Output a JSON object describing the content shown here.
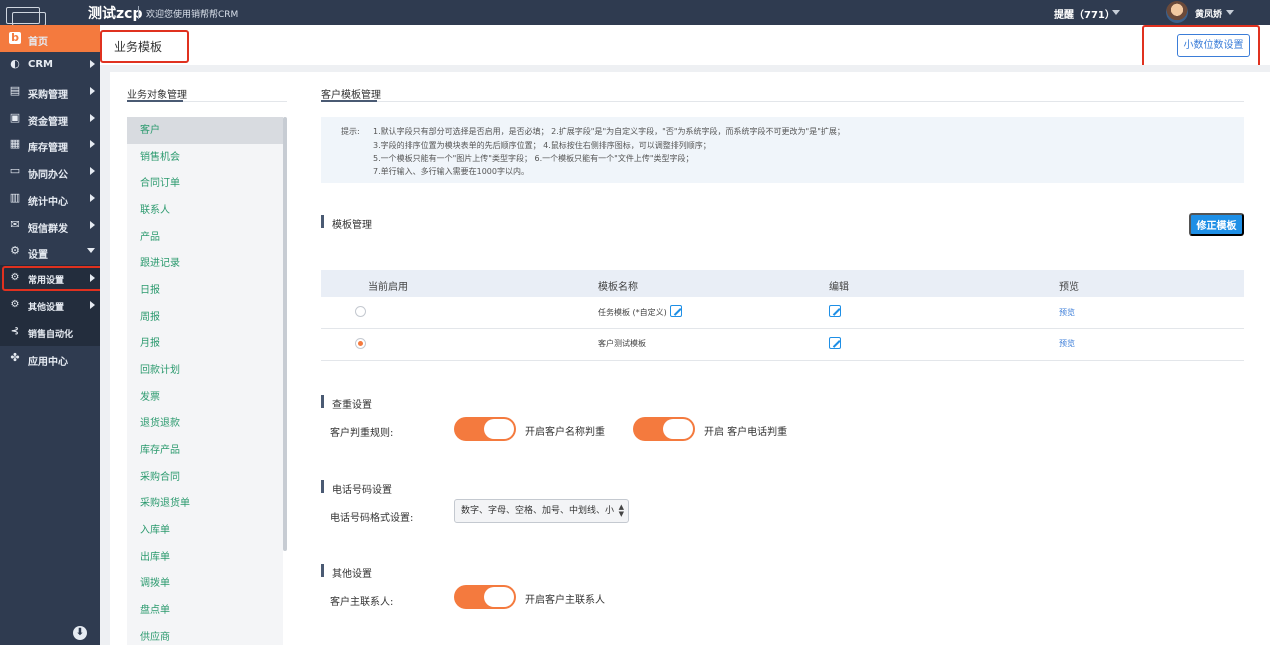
{
  "topbar": {
    "brand": "测试zcp",
    "welcome": "欢迎您使用销帮帮CRM",
    "remind": "提醒（771）",
    "username": "黄凤娇"
  },
  "sidebar": {
    "items": [
      {
        "label": "首页",
        "icon": "home-icon"
      },
      {
        "label": "CRM",
        "icon": "pie-chart-icon"
      },
      {
        "label": "采购管理",
        "icon": "purchase-icon"
      },
      {
        "label": "资金管理",
        "icon": "money-icon"
      },
      {
        "label": "库存管理",
        "icon": "inventory-icon"
      },
      {
        "label": "协同办公",
        "icon": "briefcase-icon"
      },
      {
        "label": "统计中心",
        "icon": "stats-icon"
      },
      {
        "label": "短信群发",
        "icon": "mail-icon"
      },
      {
        "label": "设置",
        "icon": "gear-icon"
      },
      {
        "label": "常用设置",
        "icon": "gear-icon"
      },
      {
        "label": "其他设置",
        "icon": "gear-icon"
      },
      {
        "label": "销售自动化",
        "icon": "automation-icon"
      },
      {
        "label": "应用中心",
        "icon": "apps-icon"
      }
    ]
  },
  "header": {
    "title": "业务模板",
    "decimal_button": "小数位数设置"
  },
  "objects": {
    "tab": "业务对象管理",
    "items": [
      "客户",
      "销售机会",
      "合同订单",
      "联系人",
      "产品",
      "跟进记录",
      "日报",
      "周报",
      "月报",
      "回款计划",
      "发票",
      "退货退款",
      "库存产品",
      "采购合同",
      "采购退货单",
      "入库单",
      "出库单",
      "调拨单",
      "盘点单",
      "供应商"
    ]
  },
  "customer": {
    "tab": "客户模板管理",
    "tips": {
      "label": "提示:",
      "lines": [
        "1.默认字段只有部分可选择是否启用，是否必填；    2.扩展字段\"是\"为自定义字段，\"否\"为系统字段，而系统字段不可更改为\"是\"扩展；",
        "3.字段的排序位置为模块表单的先后顺序位置；    4.鼠标按住右侧排序图标，可以调整排列顺序；",
        "5.一个模板只能有一个\"图片上传\"类型字段；    6.一个模板只能有一个\"文件上传\"类型字段；",
        "7.单行输入、多行输入需要在1000字以内。"
      ]
    },
    "template_section": {
      "title": "模板管理",
      "fix_button": "修正模板",
      "columns": [
        "当前启用",
        "模板名称",
        "编辑",
        "预览"
      ],
      "rows": [
        {
          "name": "任务模板 (*自定义)",
          "active": false,
          "preview": "预览"
        },
        {
          "name": "客户测试模板",
          "active": true,
          "preview": "预览"
        }
      ]
    },
    "dedupe": {
      "title": "查重设置",
      "label": "客户判重规则:",
      "toggle1": "开启客户名称判重",
      "toggle2": "开启 客户电话判重"
    },
    "phone": {
      "title": "电话号码设置",
      "label": "电话号码格式设置:",
      "selected": "数字、字母、空格、加号、中划线、小"
    },
    "other": {
      "title": "其他设置",
      "label": "客户主联系人:",
      "toggle": "开启客户主联系人"
    }
  },
  "colors": {
    "sidebar": "#2f3b50",
    "accent": "#f47a3e",
    "primary": "#1e8fe6",
    "link_green": "#2b9a6e",
    "highlight_red": "#e0311f"
  }
}
